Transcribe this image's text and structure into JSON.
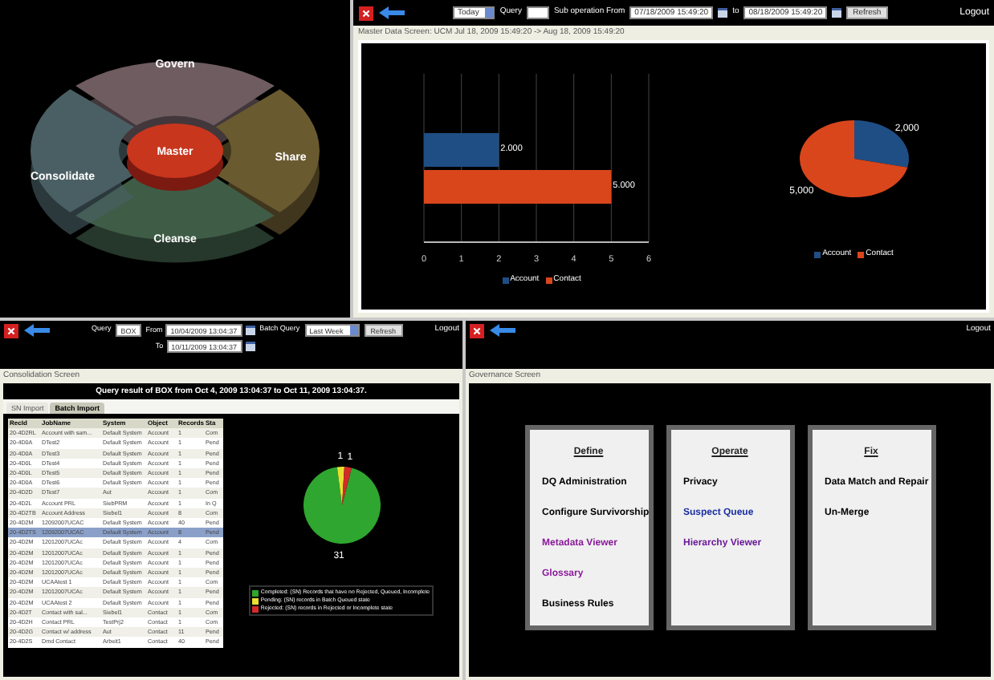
{
  "hub": {
    "center": "Master",
    "segments": [
      {
        "label": "Govern",
        "color": "#6e5c60"
      },
      {
        "label": "Share",
        "color": "#6a5a30"
      },
      {
        "label": "Cleanse",
        "color": "#3f5c47"
      },
      {
        "label": "Consolidate",
        "color": "#4a5f64"
      }
    ]
  },
  "master_data": {
    "toolbar": {
      "period": "Today",
      "query_label": "Query",
      "from_label": "Sub operation From",
      "from": "07/18/2009 15:49:20",
      "to_label": "to",
      "to": "08/18/2009 15:49:20",
      "refresh": "Refresh",
      "logout": "Logout"
    },
    "title": "Master Data Screen: UCM Jul 18, 2009 15:49:20 -> Aug 18, 2009 15:49:20",
    "bar_chart": {
      "chart_data": {
        "type": "bar",
        "orientation": "horizontal",
        "grid": true,
        "legend": true,
        "series": [
          {
            "name": "Account",
            "color": "#1f4e85",
            "values": [
              2
            ]
          },
          {
            "name": "Contact",
            "color": "#d9461c",
            "values": [
              5
            ]
          }
        ],
        "xlim": [
          0,
          6
        ],
        "xticks": [
          0,
          1,
          2,
          3,
          4,
          5,
          6
        ],
        "value_labels": [
          "2.000",
          "5.000"
        ]
      }
    },
    "pie_chart": {
      "chart_data": {
        "type": "pie",
        "categories": [
          "Account",
          "Contact"
        ],
        "values": [
          2,
          5
        ],
        "legend": true,
        "colors": [
          "#1f4e85",
          "#d9461c"
        ],
        "value_labels": [
          "2,000",
          "5,000"
        ]
      }
    }
  },
  "consolidation": {
    "toolbar": {
      "query_label": "Query",
      "query_value": "BOX",
      "from_label": "From",
      "from": "10/04/2009 13:04:37",
      "to_label": "To",
      "to": "10/11/2009 13:04:37",
      "batch_label": "Batch Query",
      "batch": "Last Week",
      "refresh": "Refresh",
      "logout": "Logout"
    },
    "title": "Consolidation Screen",
    "header": "Query result of BOX from Oct 4, 2009 13:04:37 to Oct 11, 2009 13:04:37.",
    "tabs": [
      {
        "label": "SN Import",
        "selected": false
      },
      {
        "label": "Batch Import",
        "selected": true
      }
    ],
    "table": {
      "columns": [
        "RecId",
        "JobName",
        "System",
        "Object",
        "Records",
        "Sta"
      ],
      "rows": [
        {
          "cells": [
            "20-4D2RL",
            "Account with sam...",
            "Default System",
            "Account",
            "1",
            "Com"
          ],
          "selected": false
        },
        {
          "cells": [
            "20-4D0A",
            "DTest2",
            "Default System",
            "Account",
            "1",
            "Pend"
          ],
          "selected": false
        },
        {
          "cells": [
            "20-4D0A",
            "DTest3",
            "Default System",
            "Account",
            "1",
            "Pend"
          ],
          "selected": false
        },
        {
          "cells": [
            "20-4D0L",
            "DTest4",
            "Default System",
            "Account",
            "1",
            "Pend"
          ],
          "selected": false
        },
        {
          "cells": [
            "20-4D0L",
            "DTest5",
            "Default System",
            "Account",
            "1",
            "Pend"
          ],
          "selected": false
        },
        {
          "cells": [
            "20-4D0A",
            "DTest6",
            "Default System",
            "Account",
            "1",
            "Pend"
          ],
          "selected": false
        },
        {
          "cells": [
            "20-4D2D",
            "DTest7",
            "Aut",
            "Account",
            "1",
            "Com"
          ],
          "selected": false
        },
        {
          "cells": [
            "20-4D2L",
            "Account PRL",
            "SiebPRM",
            "Account",
            "1",
            "In Q"
          ],
          "selected": false
        },
        {
          "cells": [
            "20-4D2TB",
            "Account Address",
            "Siebel1",
            "Account",
            "8",
            "Com"
          ],
          "selected": false
        },
        {
          "cells": [
            "20-4D2M",
            "12092007UCAC",
            "Default System",
            "Account",
            "40",
            "Pend"
          ],
          "selected": false
        },
        {
          "cells": [
            "20-4D2TS",
            "12092007UCAC",
            "Default System",
            "Account",
            "8",
            "Pend"
          ],
          "selected": true
        },
        {
          "cells": [
            "20-4D2M",
            "12012007UCAc",
            "Default System",
            "Account",
            "4",
            "Com"
          ],
          "selected": false
        },
        {
          "cells": [
            "20-4D2M",
            "12012007UCAc",
            "Default System",
            "Account",
            "1",
            "Pend"
          ],
          "selected": false
        },
        {
          "cells": [
            "20-4D2M",
            "12012007UCAc",
            "Default System",
            "Account",
            "1",
            "Pend"
          ],
          "selected": false
        },
        {
          "cells": [
            "20-4D2M",
            "12012007UCAc",
            "Default System",
            "Account",
            "1",
            "Pend"
          ],
          "selected": false
        },
        {
          "cells": [
            "20-4D2M",
            "UCAAtest 1",
            "Default System",
            "Account",
            "1",
            "Com"
          ],
          "selected": false
        },
        {
          "cells": [
            "20-4D2M",
            "12012007UCAc",
            "Default System",
            "Account",
            "1",
            "Pend"
          ],
          "selected": false
        },
        {
          "cells": [
            "20-4D2M",
            "UCAAtest 2",
            "Default System",
            "Account",
            "1",
            "Pend"
          ],
          "selected": false
        },
        {
          "cells": [
            "20-4D2T",
            "Contact with sal...",
            "Siebel1",
            "Contact",
            "1",
            "Com"
          ],
          "selected": false
        },
        {
          "cells": [
            "20-4D2H",
            "Contact PRL",
            "TestPrj2",
            "Contact",
            "1",
            "Com"
          ],
          "selected": false
        },
        {
          "cells": [
            "20-4D2G",
            "Contact w/ address",
            "Aut",
            "Contact",
            "11",
            "Pend"
          ],
          "selected": false
        },
        {
          "cells": [
            "20-4D2S",
            "Dmd Contact",
            "Arbeit1",
            "Contact",
            "40",
            "Pend"
          ],
          "selected": false
        }
      ]
    },
    "status_chart": {
      "chart_data": {
        "type": "pie",
        "categories": [
          "Completed: (SN) Records that have no Rejected, Queued, Incomplete",
          "Pending: (SN) records in Batch Queued state",
          "Rejected: (SN) records in Rejected or Incomplete state"
        ],
        "values": [
          31,
          1,
          1
        ],
        "legend": true,
        "colors": [
          "#2fa62f",
          "#e8e030",
          "#d42a2a"
        ],
        "value_labels": [
          "31",
          "1",
          "1"
        ]
      }
    }
  },
  "governance": {
    "logout": "Logout",
    "title": "Governance Screen",
    "cards": [
      {
        "title": "Define",
        "links": [
          {
            "text": "DQ Administration",
            "color": "#000000"
          },
          {
            "text": "Configure Survivorship",
            "color": "#000000"
          },
          {
            "text": "Metadata Viewer",
            "color": "#8a1a9a"
          },
          {
            "text": "Glossary",
            "color": "#8a1a9a"
          },
          {
            "text": "Business Rules",
            "color": "#000000"
          }
        ]
      },
      {
        "title": "Operate",
        "links": [
          {
            "text": "Privacy",
            "color": "#000000"
          },
          {
            "text": "Suspect Queue",
            "color": "#1a2fa0"
          },
          {
            "text": "Hierarchy Viewer",
            "color": "#6a1a9a"
          }
        ]
      },
      {
        "title": "Fix",
        "links": [
          {
            "text": "Data Match and Repair",
            "color": "#000000"
          },
          {
            "text": "Un-Merge",
            "color": "#000000"
          }
        ]
      }
    ]
  }
}
